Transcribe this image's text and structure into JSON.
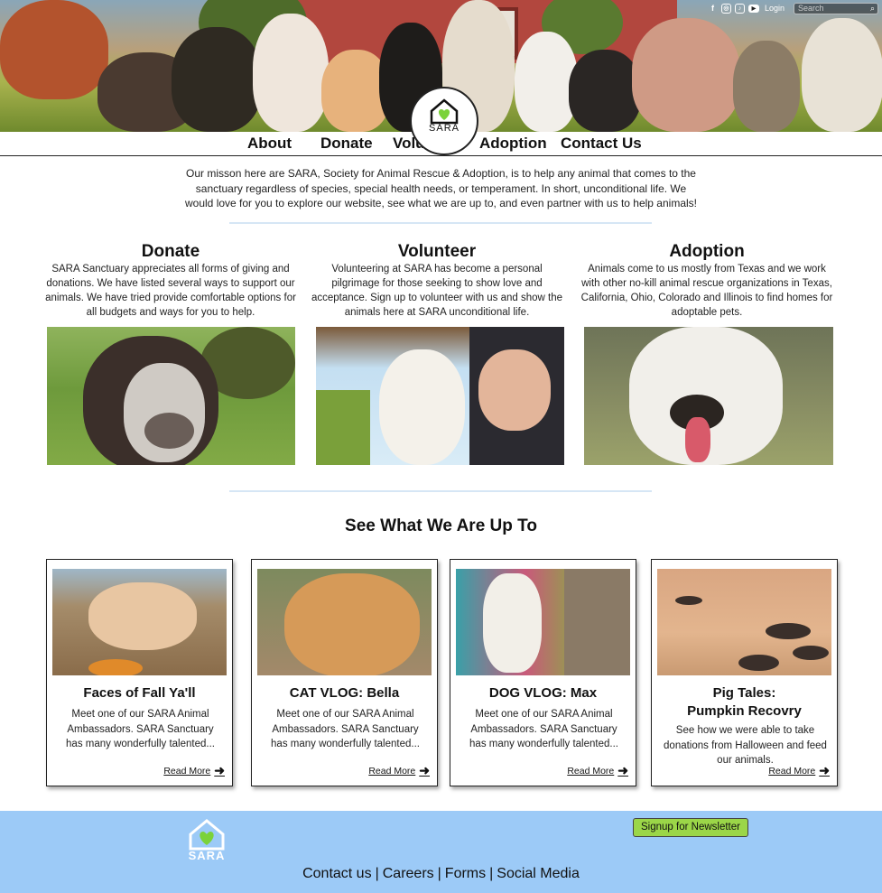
{
  "header": {
    "social_icons": [
      "facebook-icon",
      "instagram-icon",
      "tiktok-icon",
      "youtube-icon"
    ],
    "login_label": "Login",
    "search_placeholder": "Search",
    "logo_text": "SARA"
  },
  "nav": {
    "items": [
      "About",
      "Donate",
      "Volunteer",
      "Adoption",
      "Contact Us"
    ]
  },
  "mission": "Our misson here are SARA, Society for Animal Rescue & Adoption, is to help any animal that comes to the sanctuary regardless of species, special health needs, or temperament. In short, unconditional life. We would love for you to explore our website, see what we are up to, and even partner with us to help animals!",
  "columns": [
    {
      "title": "Donate",
      "text": "SARA Sanctuary appreciates all forms of giving and donations. We have listed several ways to support our animals. We have tried provide comfortable options for all budgets and ways for you to help."
    },
    {
      "title": "Volunteer",
      "text": "Volunteering at SARA has become a personal pilgrimage for those seeking to show love and acceptance. Sign up to volunteer with us and show the animals here at SARA unconditional life."
    },
    {
      "title": "Adoption",
      "text": "Animals come to us mostly from Texas and we work with other no-kill animal rescue organizations in Texas, California, Ohio, Colorado and Illinois to find homes for adoptable pets."
    }
  ],
  "updates": {
    "title": "See What We Are Up To",
    "cards": [
      {
        "title": "Faces of Fall Ya'll",
        "text": "Meet one of our SARA Animal Ambassadors. SARA Sanctuary has many wonderfully talented...",
        "link": "Read More"
      },
      {
        "title": "CAT VLOG: Bella",
        "text": "Meet one of our SARA Animal Ambassadors. SARA Sanctuary has many wonderfully talented...",
        "link": "Read More"
      },
      {
        "title": "DOG VLOG: Max",
        "text": "Meet one of our SARA Animal Ambassadors. SARA Sanctuary has many wonderfully talented...",
        "link": "Read More"
      },
      {
        "title": "Pig Tales:\nPumpkin Recovry",
        "text": "See how we were able to take donations from Halloween and feed our animals.",
        "link": "Read More"
      }
    ]
  },
  "footer": {
    "logo_text": "SARA",
    "newsletter_label": "Signup for Newsletter",
    "links": [
      "Contact us",
      "Careers",
      "Forms",
      "Social Media"
    ]
  },
  "colors": {
    "footer_bg": "#9ccaf7",
    "newsletter_bg": "#9bd648",
    "heart_green": "#7bd23a",
    "divider": "#d6e6f5"
  }
}
